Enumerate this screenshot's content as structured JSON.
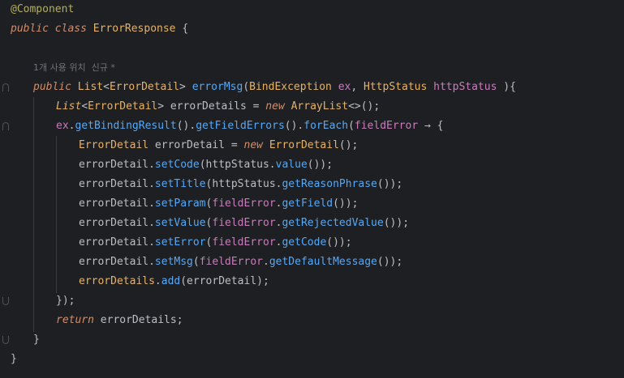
{
  "editor": {
    "lines": [
      {
        "tokens": [
          {
            "t": "@Component",
            "c": "ann"
          }
        ]
      },
      {
        "tokens": [
          {
            "t": "public",
            "c": "kw"
          },
          {
            "t": " ",
            "c": "plain"
          },
          {
            "t": "class",
            "c": "kw"
          },
          {
            "t": " ",
            "c": "plain"
          },
          {
            "t": "ErrorResponse",
            "c": "def"
          },
          {
            "t": " {",
            "c": "plain"
          }
        ]
      },
      {
        "tokens": []
      },
      {
        "hint": "1개 사용 위치  신규 *"
      },
      {
        "tokens": [
          {
            "t": "public",
            "c": "kw"
          },
          {
            "t": " ",
            "c": "plain"
          },
          {
            "t": "List",
            "c": "def"
          },
          {
            "t": "<",
            "c": "plain"
          },
          {
            "t": "ErrorDetail",
            "c": "def"
          },
          {
            "t": "> ",
            "c": "plain"
          },
          {
            "t": "errorMsg",
            "c": "method"
          },
          {
            "t": "(",
            "c": "plain"
          },
          {
            "t": "BindException",
            "c": "def"
          },
          {
            "t": " ",
            "c": "plain"
          },
          {
            "t": "ex",
            "c": "param"
          },
          {
            "t": ", ",
            "c": "plain"
          },
          {
            "t": "HttpStatus",
            "c": "def"
          },
          {
            "t": " ",
            "c": "plain"
          },
          {
            "t": "httpStatus",
            "c": "param"
          },
          {
            "t": " ){",
            "c": "plain"
          }
        ]
      },
      {
        "tokens": [
          {
            "t": "List",
            "c": "kwdef"
          },
          {
            "t": "<",
            "c": "plain"
          },
          {
            "t": "ErrorDetail",
            "c": "def"
          },
          {
            "t": "> errorDetails = ",
            "c": "plain"
          },
          {
            "t": "new",
            "c": "kw"
          },
          {
            "t": " ",
            "c": "plain"
          },
          {
            "t": "ArrayList",
            "c": "def"
          },
          {
            "t": "<>();",
            "c": "plain"
          }
        ]
      },
      {
        "tokens": [
          {
            "t": "ex",
            "c": "param"
          },
          {
            "t": ".",
            "c": "plain"
          },
          {
            "t": "getBindingResult",
            "c": "call"
          },
          {
            "t": "().",
            "c": "plain"
          },
          {
            "t": "getFieldErrors",
            "c": "call"
          },
          {
            "t": "().",
            "c": "plain"
          },
          {
            "t": "forEach",
            "c": "call"
          },
          {
            "t": "(",
            "c": "plain"
          },
          {
            "t": "fieldError",
            "c": "param"
          },
          {
            "t": " → {",
            "c": "plain"
          }
        ]
      },
      {
        "tokens": [
          {
            "t": "ErrorDetail",
            "c": "def"
          },
          {
            "t": " errorDetail = ",
            "c": "plain"
          },
          {
            "t": "new",
            "c": "kw"
          },
          {
            "t": " ",
            "c": "plain"
          },
          {
            "t": "ErrorDetail",
            "c": "def"
          },
          {
            "t": "();",
            "c": "plain"
          }
        ]
      },
      {
        "tokens": [
          {
            "t": "errorDetail.",
            "c": "plain"
          },
          {
            "t": "setCode",
            "c": "call"
          },
          {
            "t": "(httpStatus.",
            "c": "plain"
          },
          {
            "t": "value",
            "c": "call"
          },
          {
            "t": "());",
            "c": "plain"
          }
        ]
      },
      {
        "tokens": [
          {
            "t": "errorDetail.",
            "c": "plain"
          },
          {
            "t": "setTitle",
            "c": "call"
          },
          {
            "t": "(httpStatus.",
            "c": "plain"
          },
          {
            "t": "getReasonPhrase",
            "c": "call"
          },
          {
            "t": "());",
            "c": "plain"
          }
        ]
      },
      {
        "tokens": [
          {
            "t": "errorDetail.",
            "c": "plain"
          },
          {
            "t": "setParam",
            "c": "call"
          },
          {
            "t": "(",
            "c": "plain"
          },
          {
            "t": "fieldError",
            "c": "param"
          },
          {
            "t": ".",
            "c": "plain"
          },
          {
            "t": "getField",
            "c": "call"
          },
          {
            "t": "());",
            "c": "plain"
          }
        ]
      },
      {
        "tokens": [
          {
            "t": "errorDetail.",
            "c": "plain"
          },
          {
            "t": "setValue",
            "c": "call"
          },
          {
            "t": "(",
            "c": "plain"
          },
          {
            "t": "fieldError",
            "c": "param"
          },
          {
            "t": ".",
            "c": "plain"
          },
          {
            "t": "getRejectedValue",
            "c": "call"
          },
          {
            "t": "());",
            "c": "plain"
          }
        ]
      },
      {
        "tokens": [
          {
            "t": "errorDetail.",
            "c": "plain"
          },
          {
            "t": "setError",
            "c": "call"
          },
          {
            "t": "(",
            "c": "plain"
          },
          {
            "t": "fieldError",
            "c": "param"
          },
          {
            "t": ".",
            "c": "plain"
          },
          {
            "t": "getCode",
            "c": "call"
          },
          {
            "t": "());",
            "c": "plain"
          }
        ]
      },
      {
        "tokens": [
          {
            "t": "errorDetail.",
            "c": "plain"
          },
          {
            "t": "setMsg",
            "c": "call"
          },
          {
            "t": "(",
            "c": "plain"
          },
          {
            "t": "fieldError",
            "c": "param"
          },
          {
            "t": ".",
            "c": "plain"
          },
          {
            "t": "getDefaultMessage",
            "c": "call"
          },
          {
            "t": "());",
            "c": "plain"
          }
        ]
      },
      {
        "tokens": [
          {
            "t": "errorDetails",
            "c": "def"
          },
          {
            "t": ".",
            "c": "plain"
          },
          {
            "t": "add",
            "c": "call"
          },
          {
            "t": "(errorDetail);",
            "c": "plain"
          }
        ]
      },
      {
        "tokens": [
          {
            "t": "});",
            "c": "plain"
          }
        ]
      },
      {
        "tokens": [
          {
            "t": "return",
            "c": "kw"
          },
          {
            "t": " errorDetails;",
            "c": "plain"
          }
        ]
      },
      {
        "tokens": [
          {
            "t": "}",
            "c": "plain"
          }
        ]
      },
      {
        "tokens": [
          {
            "t": "}",
            "c": "plain"
          }
        ]
      }
    ]
  },
  "colors": {
    "background": "#1e1f22",
    "plain": "#bcbec4",
    "keyword": "#cf8e6d",
    "annotation": "#b3ae60",
    "definition": "#e6b266",
    "method": "#56a8f5",
    "call": "#56a8f5",
    "parameter": "#c77dbb",
    "hint": "#6f737a",
    "guide": "#393b40"
  }
}
